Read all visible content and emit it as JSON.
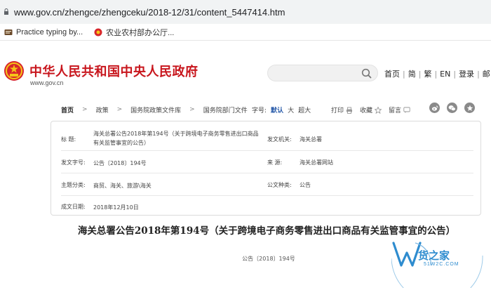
{
  "browser": {
    "url": "www.gov.cn/zhengce/zhengceku/2018-12/31/content_5447414.htm",
    "bookmarks": [
      {
        "label": "Practice typing by...",
        "icon": "typing-icon"
      },
      {
        "label": "农业农村部办公厅...",
        "icon": "ministry-icon"
      }
    ]
  },
  "site": {
    "title": "中华人民共和国中央人民政府",
    "domain": "www.gov.cn",
    "search_placeholder": "",
    "nav": [
      "首页",
      "简",
      "繁",
      "EN",
      "登录",
      "邮"
    ]
  },
  "breadcrumb": {
    "items": [
      "首页",
      "政策",
      "国务院政策文件库",
      "国务院部门文件"
    ]
  },
  "font_size": {
    "label": "字号:",
    "options": [
      "默认",
      "大",
      "超大"
    ],
    "selected": "默认"
  },
  "tools": {
    "print": "打印",
    "favorite": "收藏",
    "comment": "留言"
  },
  "info": {
    "title_label": "标 题:",
    "title_value": "海关总署公告2018年第194号（关于跨境电子商务零售进出口商品有关监管事宜的公告）",
    "issuer_label": "发文机关:",
    "issuer_value": "海关总署",
    "docno_label": "发文字号:",
    "docno_value": "公告〔2018〕194号",
    "source_label": "来 源:",
    "source_value": "海关总署网站",
    "topic_label": "主题分类:",
    "topic_value": "商贸、海关、旅游\\海关",
    "doctype_label": "公文种类:",
    "doctype_value": "公告",
    "date_label": "成文日期:",
    "date_value": "2018年12月10日"
  },
  "article": {
    "title": "海关总署公告2018年第194号（关于跨境电子商务零售进出口商品有关监管事宜的公告）",
    "number": "公告〔2018〕194号"
  },
  "watermark": {
    "text": "货之家",
    "sub": "51W2C.COM"
  },
  "colors": {
    "brand_red": "#c8161d",
    "link_blue": "#2a5caa",
    "watermark_blue": "#2e8ccf"
  }
}
